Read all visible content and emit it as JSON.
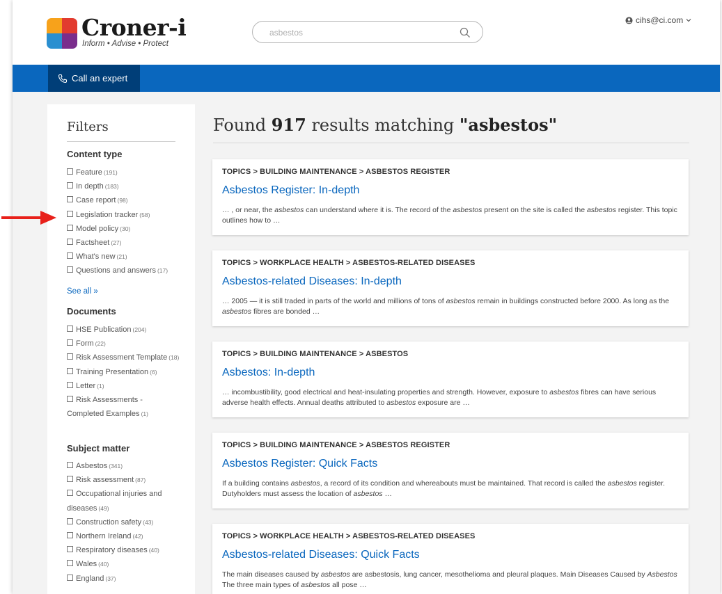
{
  "header": {
    "logo_name": "Croner-i",
    "logo_tagline": "Inform • Advise • Protect",
    "search_value": "asbestos",
    "user_email": "cihs@ci.com"
  },
  "nav": {
    "call_label": "Call an expert"
  },
  "sidebar": {
    "title": "Filters",
    "content_type": {
      "heading": "Content type",
      "items": [
        {
          "label": "Feature",
          "count": "(191)"
        },
        {
          "label": "In depth",
          "count": "(183)"
        },
        {
          "label": "Case report",
          "count": "(98)"
        },
        {
          "label": "Legislation tracker",
          "count": "(58)"
        },
        {
          "label": "Model policy",
          "count": "(30)"
        },
        {
          "label": "Factsheet",
          "count": "(27)"
        },
        {
          "label": "What's new",
          "count": "(21)"
        },
        {
          "label": "Questions and answers",
          "count": "(17)"
        }
      ],
      "see_all": "See all »"
    },
    "documents": {
      "heading": "Documents",
      "items": [
        {
          "label": "HSE Publication",
          "count": "(204)"
        },
        {
          "label": "Form",
          "count": "(22)"
        },
        {
          "label": "Risk Assessment Template",
          "count": "(18)"
        },
        {
          "label": "Training Presentation",
          "count": "(6)"
        },
        {
          "label": "Letter",
          "count": "(1)"
        },
        {
          "label": "Risk Assessments - Completed Examples",
          "count": "(1)"
        }
      ]
    },
    "subject_matter": {
      "heading": "Subject matter",
      "items": [
        {
          "label": "Asbestos",
          "count": "(341)"
        },
        {
          "label": "Risk assessment",
          "count": "(87)"
        },
        {
          "label": "Occupational injuries and diseases",
          "count": "(49)"
        },
        {
          "label": "Construction safety",
          "count": "(43)"
        },
        {
          "label": "Northern Ireland",
          "count": "(42)"
        },
        {
          "label": "Respiratory diseases",
          "count": "(40)"
        },
        {
          "label": "Wales",
          "count": "(40)"
        },
        {
          "label": "England",
          "count": "(37)"
        }
      ]
    }
  },
  "results": {
    "prefix": "Found ",
    "count": "917",
    "middle": " results matching ",
    "query": "\"asbestos\"",
    "items": [
      {
        "crumb": "TOPICS > BUILDING MAINTENANCE > ASBESTOS REGISTER",
        "title": "Asbestos Register: In-depth",
        "snippet": [
          {
            "t": "… , or near, the "
          },
          {
            "i": "asbestos"
          },
          {
            "t": " can understand where it is. The record of the "
          },
          {
            "i": "asbestos"
          },
          {
            "t": " present on the site is called the "
          },
          {
            "i": "asbestos"
          },
          {
            "t": " register. This topic outlines how to …"
          }
        ]
      },
      {
        "crumb": "TOPICS > WORKPLACE HEALTH > ASBESTOS-RELATED DISEASES",
        "title": "Asbestos-related Diseases: In-depth",
        "snippet": [
          {
            "t": "… 2005 — it is still traded in parts of the world and millions of tons of "
          },
          {
            "i": "asbestos"
          },
          {
            "t": " remain in buildings constructed before 2000. As long as the "
          },
          {
            "i": "asbestos"
          },
          {
            "t": " fibres are bonded …"
          }
        ]
      },
      {
        "crumb": "TOPICS > BUILDING MAINTENANCE > ASBESTOS",
        "title": "Asbestos: In-depth",
        "snippet": [
          {
            "t": "… incombustibility, good electrical and heat-insulating properties and strength. However, exposure to "
          },
          {
            "i": "asbestos"
          },
          {
            "t": " fibres can have serious adverse health effects. Annual deaths attributed to "
          },
          {
            "i": "asbestos"
          },
          {
            "t": " exposure are …"
          }
        ]
      },
      {
        "crumb": "TOPICS > BUILDING MAINTENANCE > ASBESTOS REGISTER",
        "title": "Asbestos Register: Quick Facts",
        "snippet": [
          {
            "t": "If a building contains "
          },
          {
            "i": "asbestos"
          },
          {
            "t": ", a record of its condition and whereabouts must be maintained. That record is called the "
          },
          {
            "i": "asbestos"
          },
          {
            "t": " register. Dutyholders must assess the location of "
          },
          {
            "i": "asbestos"
          },
          {
            "t": " …"
          }
        ]
      },
      {
        "crumb": "TOPICS > WORKPLACE HEALTH > ASBESTOS-RELATED DISEASES",
        "title": "Asbestos-related Diseases: Quick Facts",
        "snippet": [
          {
            "t": "The main diseases caused by "
          },
          {
            "i": "asbestos"
          },
          {
            "t": " are asbestosis, lung cancer, mesothelioma and pleural plaques. Main Diseases Caused by "
          },
          {
            "i": "Asbestos"
          },
          {
            "t": " The three main types of "
          },
          {
            "i": "asbestos"
          },
          {
            "t": " all pose …"
          }
        ]
      }
    ]
  },
  "colors": {
    "brand_blue": "#0a67be",
    "nav_dark": "#003e78",
    "arrow_red": "#e8201a"
  },
  "icons": {
    "search": "search-icon",
    "user": "user-icon",
    "caret": "chevron-down-icon",
    "phone": "phone-icon",
    "arrow": "red-arrow-icon"
  }
}
